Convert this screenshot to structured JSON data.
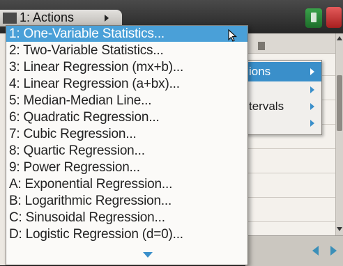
{
  "menu": {
    "header_label": "1: Actions",
    "items": [
      {
        "label": "1: One-Variable Statistics..."
      },
      {
        "label": "2: Two-Variable Statistics..."
      },
      {
        "label": "3: Linear Regression (mx+b)..."
      },
      {
        "label": "4: Linear Regression (a+bx)..."
      },
      {
        "label": "5: Median-Median Line..."
      },
      {
        "label": "6: Quadratic Regression..."
      },
      {
        "label": "7: Cubic Regression..."
      },
      {
        "label": "8: Quartic Regression..."
      },
      {
        "label": "9: Power Regression..."
      },
      {
        "label": "A: Exponential Regression..."
      },
      {
        "label": "B: Logarithmic Regression..."
      },
      {
        "label": "C: Sinusoidal Regression..."
      },
      {
        "label": "D: Logistic Regression (d=0)..."
      }
    ]
  },
  "submenu": {
    "items": [
      {
        "label": "ions"
      },
      {
        "label": ""
      },
      {
        "label": "tervals"
      },
      {
        "label": ""
      }
    ]
  },
  "colors": {
    "highlight": "#4aa0d8",
    "arrow": "#3a8fca"
  }
}
